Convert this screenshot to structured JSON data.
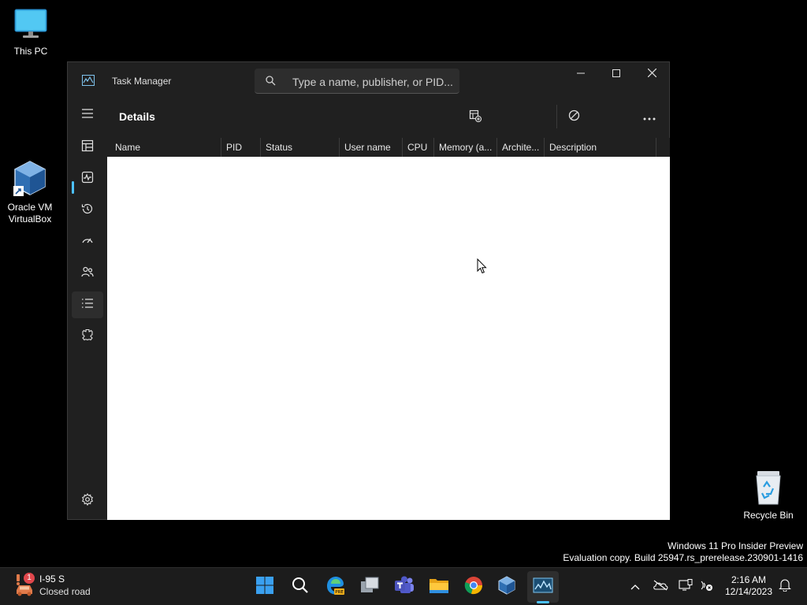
{
  "desktop": {
    "icons": [
      {
        "label": "This PC"
      },
      {
        "label": "Oracle VM\nVirtualBox"
      },
      {
        "label": "Recycle Bin"
      }
    ],
    "watermark": {
      "line1": "Windows 11 Pro Insider Preview",
      "line2": "Evaluation copy. Build 25947.rs_prerelease.230901-1416"
    }
  },
  "window": {
    "title": "Task Manager",
    "search_placeholder": "Type a name, publisher, or PID...",
    "controls": [
      "minimize-icon",
      "maximize-icon",
      "close-icon"
    ],
    "nav": {
      "items": [
        {
          "icon": "hamburger-icon"
        },
        {
          "icon": "processes-icon",
          "active": false
        },
        {
          "icon": "performance-icon"
        },
        {
          "icon": "app-history-icon"
        },
        {
          "icon": "startup-apps-icon"
        },
        {
          "icon": "users-icon"
        },
        {
          "icon": "details-icon",
          "active": true
        },
        {
          "icon": "services-icon"
        }
      ],
      "settings_icon": "gear-icon"
    },
    "page": {
      "title": "Details",
      "commands": [
        "run-new-task-icon",
        "end-task-icon",
        "more-icon"
      ]
    },
    "table": {
      "columns": [
        "Name",
        "PID",
        "Status",
        "User name",
        "CPU",
        "Memory (a...",
        "Archite...",
        "Description"
      ],
      "rows": []
    }
  },
  "taskbar": {
    "weather": {
      "badge": "1",
      "line1": "I-95 S",
      "line2": "Closed road"
    },
    "apps": [
      "start-icon",
      "search-icon",
      "edge-pre-icon",
      "task-view-icon",
      "teams-icon",
      "file-explorer-icon",
      "chrome-icon",
      "virtualbox-icon",
      "task-manager-icon"
    ],
    "active_app": "task-manager-icon",
    "tray": [
      "chevron-up-icon",
      "onedrive-icon",
      "display-icon",
      "network-icon",
      "notifications-icon"
    ],
    "clock": {
      "time": "2:16 AM",
      "date": "12/14/2023"
    }
  },
  "colors": {
    "accent": "#4cc2ff",
    "window_bg": "#202020",
    "table_bg": "#ffffff",
    "taskbar_bg": "#1c1c1c"
  }
}
